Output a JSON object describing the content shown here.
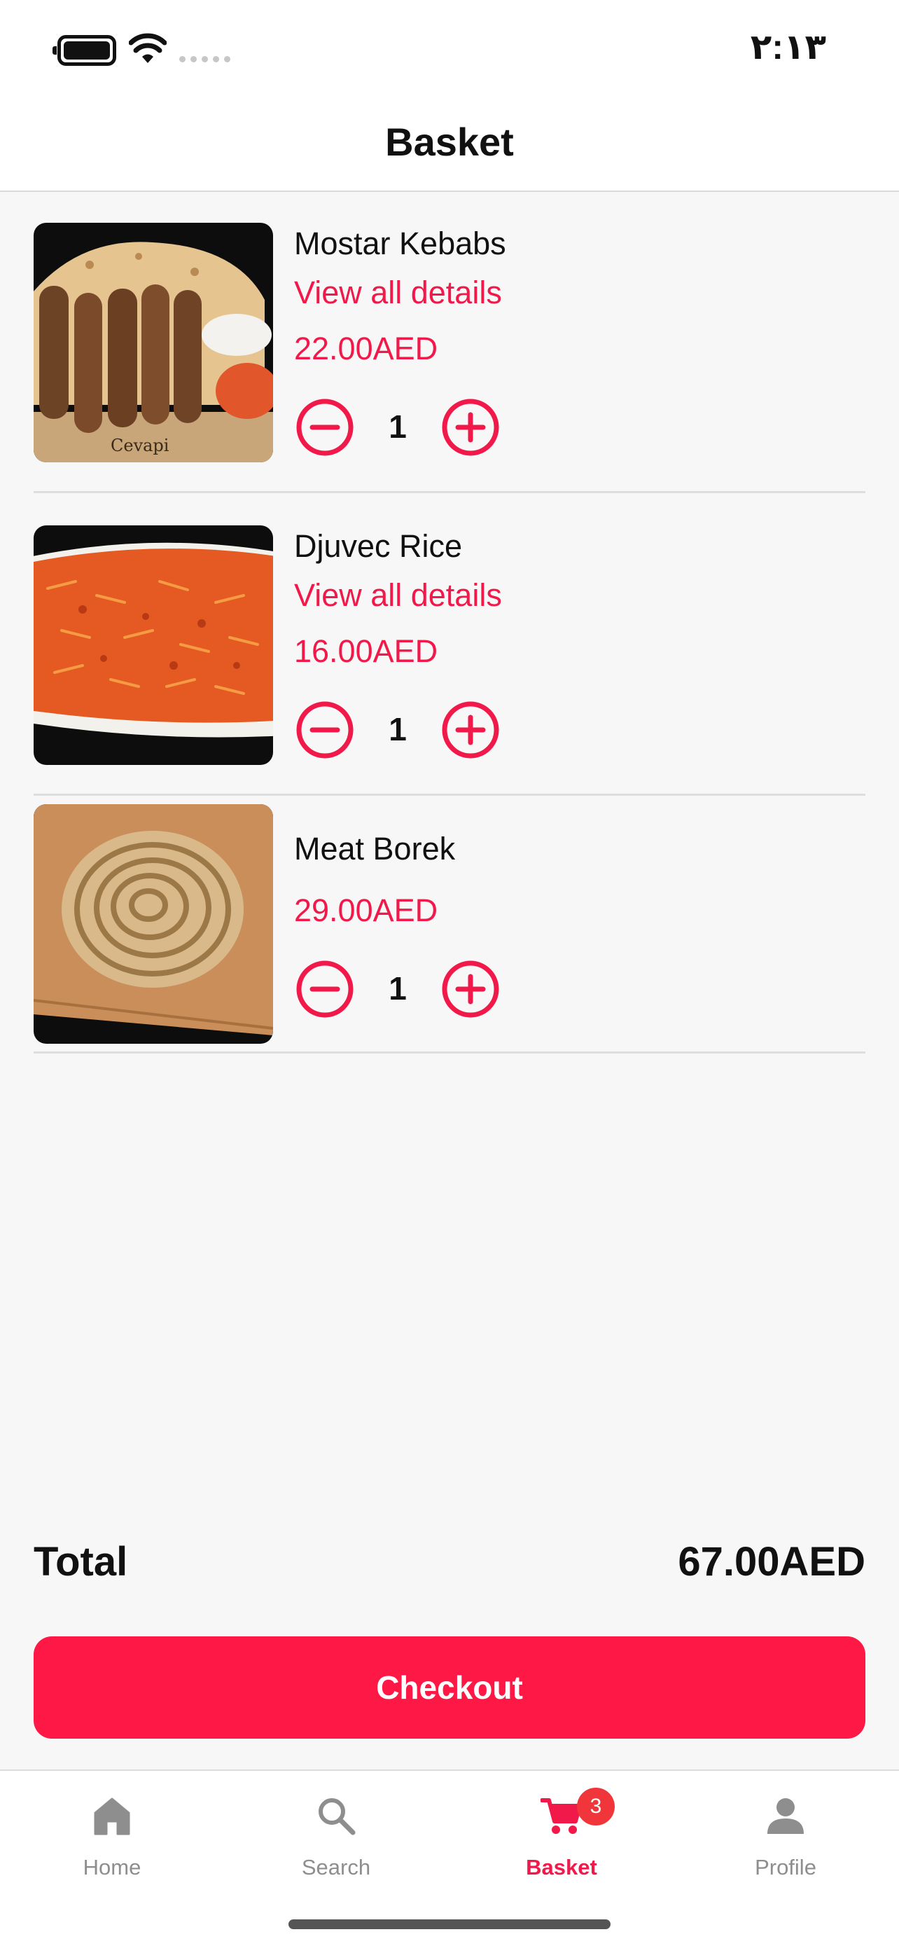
{
  "status_bar": {
    "time": "٢:١٣"
  },
  "header": {
    "title": "Basket"
  },
  "basket": {
    "items": [
      {
        "name": "Mostar Kebabs",
        "details_link": "View all details",
        "price": "22.00AED",
        "quantity": "1"
      },
      {
        "name": "Djuvec Rice",
        "details_link": "View all details",
        "price": "16.00AED",
        "quantity": "1"
      },
      {
        "name": "Meat Borek",
        "price": "29.00AED",
        "quantity": "1"
      }
    ]
  },
  "summary": {
    "total_label": "Total",
    "total_value": "67.00AED"
  },
  "checkout": {
    "label": "Checkout"
  },
  "tab_bar": {
    "tabs": [
      {
        "label": "Home",
        "icon": "home-icon"
      },
      {
        "label": "Search",
        "icon": "search-icon"
      },
      {
        "label": "Basket",
        "icon": "cart-icon",
        "badge": "3",
        "active": true
      },
      {
        "label": "Profile",
        "icon": "profile-icon"
      }
    ]
  },
  "colors": {
    "accent": "#f0194a",
    "checkout_button": "#fd1846",
    "badge": "#f0353b",
    "inactive_tab": "#8e8e8e",
    "background": "#f7f7f7"
  }
}
